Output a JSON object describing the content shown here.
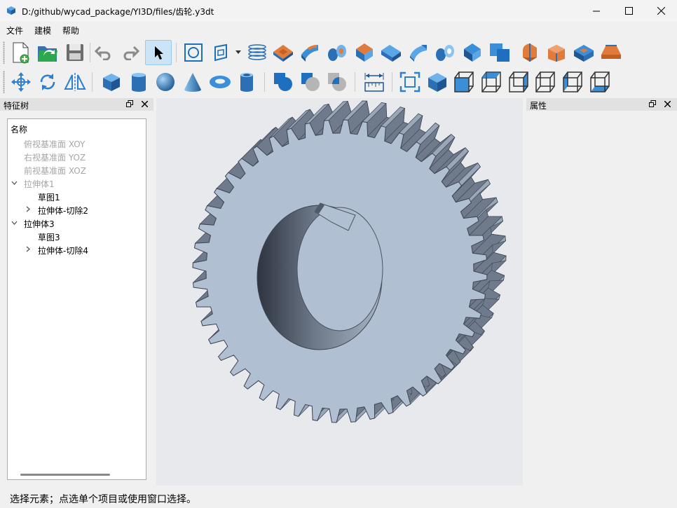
{
  "window": {
    "title": "D:/github/wycad_package/YI3D/files/齿轮.y3dt",
    "minimize_icon": "minimize-icon",
    "maximize_icon": "maximize-icon",
    "close_icon": "close-icon"
  },
  "menu": {
    "file": "文件",
    "modeling": "建模",
    "help": "帮助"
  },
  "toolbar1": {
    "buttons": [
      "new-file-icon",
      "open-file-icon",
      "save-icon",
      "undo-icon",
      "redo-icon",
      "select-pointer-icon",
      "sketch-circle-icon",
      "sketch-plane-icon",
      "dropdown-arrow-icon",
      "helix-icon",
      "extrude-icon",
      "revolve-icon",
      "sweep-icon",
      "loft-icon",
      "fillet-icon",
      "chamfer-icon",
      "shell-icon",
      "draft-icon",
      "boolean-icon",
      "feature-fillet-icon",
      "feature-chamfer-icon",
      "pocket-icon",
      "rib-icon"
    ]
  },
  "toolbar2": {
    "buttons": [
      "move-icon",
      "rotate-icon",
      "mirror-icon",
      "box-icon",
      "cylinder-icon",
      "sphere-icon",
      "cone-icon",
      "torus-icon",
      "tube-icon",
      "boolean-union-icon",
      "boolean-cut-icon",
      "boolean-intersect-icon",
      "measure-icon",
      "fit-all-icon",
      "iso-view-icon",
      "front-view-icon",
      "top-view-icon",
      "right-view-icon",
      "back-view-icon",
      "left-view-icon",
      "bottom-view-icon"
    ]
  },
  "feature_tree": {
    "title": "特征树",
    "float_icon": "float-icon",
    "close_icon": "close-icon",
    "column_header": "名称",
    "items": [
      {
        "label": "俯视基准面 XOY",
        "dim": true
      },
      {
        "label": "右视基准面 YOZ",
        "dim": true
      },
      {
        "label": "前视基准面 XOZ",
        "dim": true
      },
      {
        "label": "拉伸体1",
        "dim": true,
        "expanded": true
      },
      {
        "label": "草图1"
      },
      {
        "label": "拉伸体-切除2",
        "expanded": false
      },
      {
        "label": "拉伸体3",
        "expanded": true
      },
      {
        "label": "草图3"
      },
      {
        "label": "拉伸体-切除4",
        "expanded": false
      }
    ]
  },
  "properties": {
    "title": "属性"
  },
  "colors": {
    "gear_face": "#b0bfd2",
    "gear_side": "#6f7b8c",
    "icon_blue": "#3a8fd8",
    "icon_orange": "#e07b3c"
  },
  "status": {
    "text": "选择元素；点选单个项目或使用窗口选择。"
  }
}
